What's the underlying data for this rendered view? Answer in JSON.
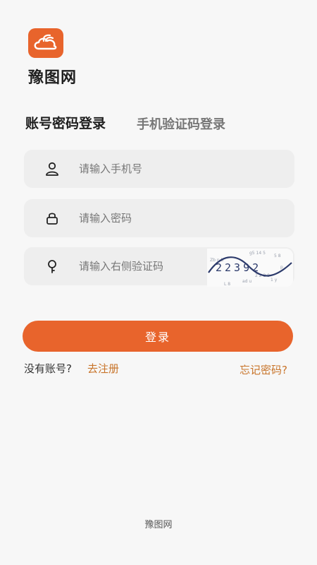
{
  "app": {
    "name": "豫图网"
  },
  "tabs": [
    {
      "label": "账号密码登录",
      "active": true
    },
    {
      "label": "手机验证码登录",
      "active": false
    }
  ],
  "form": {
    "phone_placeholder": "请输入手机号",
    "password_placeholder": "请输入密码",
    "captcha_placeholder": "请输入右侧验证码",
    "captcha_text": "22392"
  },
  "actions": {
    "login_label": "登录",
    "no_account_text": "没有账号?",
    "register_label": "去注册",
    "forgot_label": "忘记密码?"
  },
  "footer": {
    "text": "豫图网"
  },
  "colors": {
    "accent": "#e8642c",
    "link": "#c8742a",
    "field_bg": "#eeeeee"
  },
  "icons": {
    "logo": "cloud-rabbit-icon",
    "phone": "user-icon",
    "password": "lock-icon",
    "captcha": "key-icon"
  }
}
